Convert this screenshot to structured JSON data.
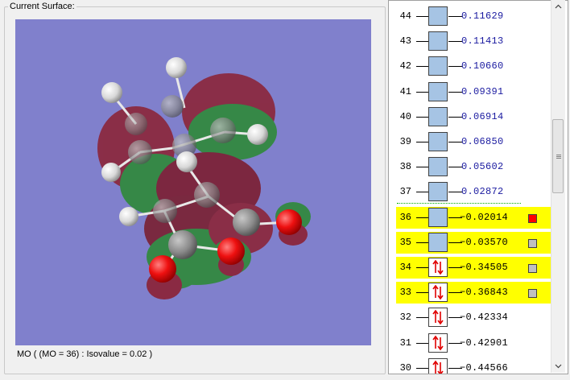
{
  "panel": {
    "title": "Current Surface:",
    "caption": "MO ( (MO = 36) : Isovalue = 0.02 )"
  },
  "orbitals": [
    {
      "num": "44",
      "energy": "0.11629",
      "occupied": false,
      "highlight": false,
      "marker": "none"
    },
    {
      "num": "43",
      "energy": "0.11413",
      "occupied": false,
      "highlight": false,
      "marker": "none"
    },
    {
      "num": "42",
      "energy": "0.10660",
      "occupied": false,
      "highlight": false,
      "marker": "none"
    },
    {
      "num": "41",
      "energy": "0.09391",
      "occupied": false,
      "highlight": false,
      "marker": "none"
    },
    {
      "num": "40",
      "energy": "0.06914",
      "occupied": false,
      "highlight": false,
      "marker": "none"
    },
    {
      "num": "39",
      "energy": "0.06850",
      "occupied": false,
      "highlight": false,
      "marker": "none"
    },
    {
      "num": "38",
      "energy": "0.05602",
      "occupied": false,
      "highlight": false,
      "marker": "none"
    },
    {
      "num": "37",
      "energy": "0.02872",
      "occupied": false,
      "highlight": false,
      "marker": "none"
    },
    {
      "num": "36",
      "energy": "−0.02014",
      "occupied": false,
      "highlight": true,
      "marker": "red"
    },
    {
      "num": "35",
      "energy": "−0.03570",
      "occupied": false,
      "highlight": true,
      "marker": "gray"
    },
    {
      "num": "34",
      "energy": "−0.34505",
      "occupied": true,
      "highlight": true,
      "marker": "gray"
    },
    {
      "num": "33",
      "energy": "−0.36843",
      "occupied": true,
      "highlight": true,
      "marker": "gray"
    },
    {
      "num": "32",
      "energy": "−0.42334",
      "occupied": true,
      "highlight": false,
      "marker": "none"
    },
    {
      "num": "31",
      "energy": "−0.42901",
      "occupied": true,
      "highlight": false,
      "marker": "none"
    },
    {
      "num": "30",
      "energy": "−0.44566",
      "occupied": true,
      "highlight": false,
      "marker": "none"
    }
  ],
  "colors": {
    "viewport_bg": "#8080cc",
    "highlight": "#ffff00",
    "selected_marker": "#ff0000",
    "unoccupied_box": "#a6c4e4",
    "lobe_positive": "#1e8c2a",
    "lobe_negative": "#8c1c2c"
  },
  "scrollbar": {
    "position_fraction": 0.42
  }
}
